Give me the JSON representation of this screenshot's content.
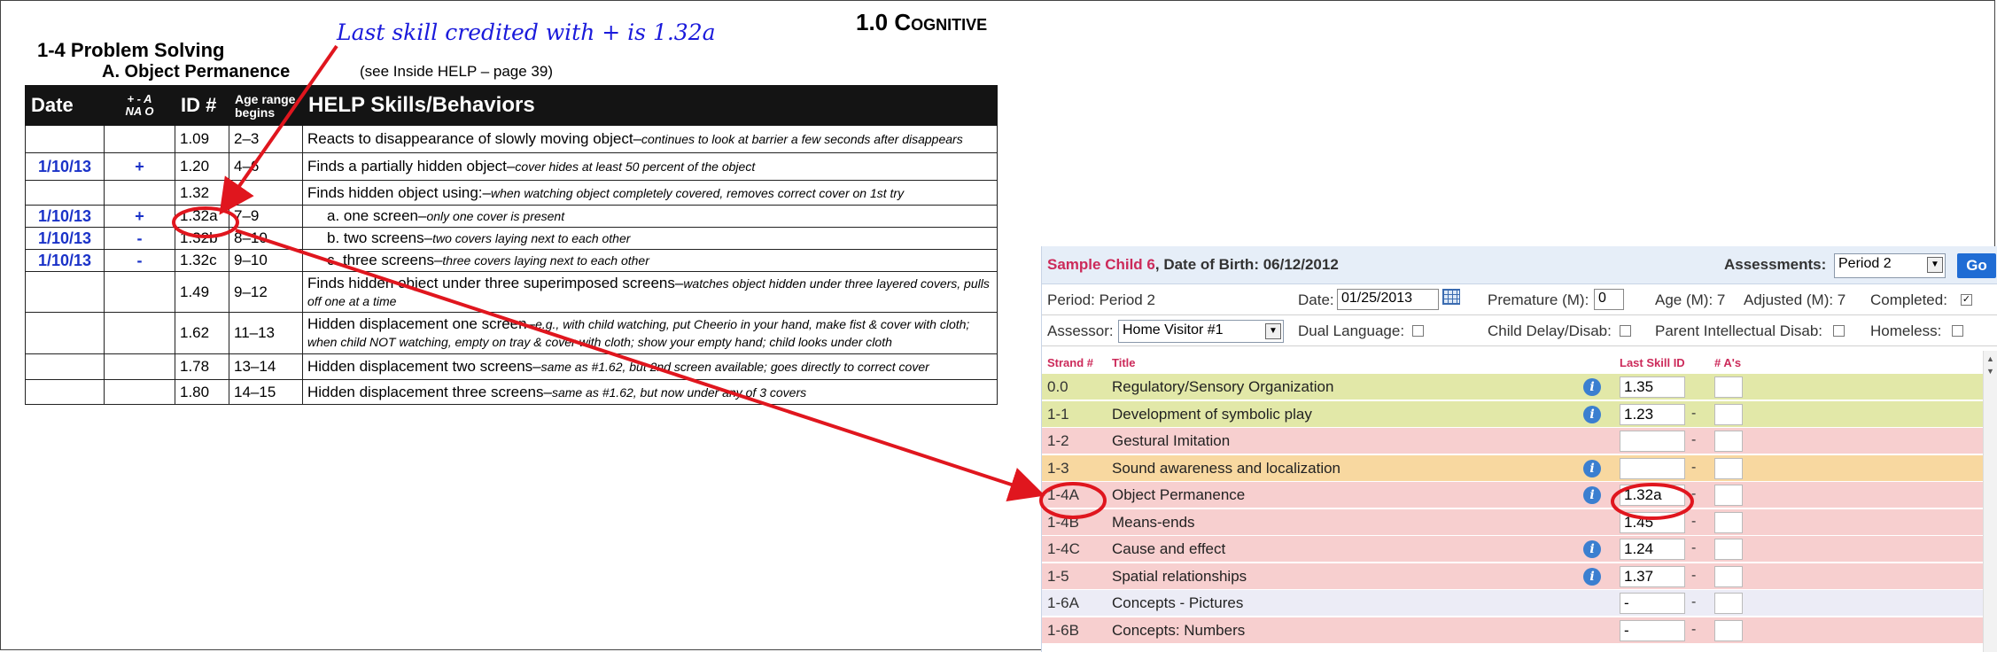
{
  "callout": "Last skill credited with + is 1.32a",
  "worksheet": {
    "domain_num": "1.0",
    "domain_name": "Cognitive",
    "section": "1-4 Problem Solving",
    "subsection": "A. Object Permanence",
    "reference": "(see Inside HELP – page 39)",
    "headers": {
      "date": "Date",
      "marks_top": "+ - A",
      "marks_bottom": "NA O",
      "id": "ID #",
      "age_top": "Age range",
      "age_bottom": "begins",
      "skills": "HELP Skills/Behaviors"
    },
    "rows": [
      {
        "date": "",
        "mark": "",
        "id": "1.09",
        "age": "2–3",
        "skill": "Reacts to disappearance of slowly moving object–",
        "desc": "continues to look at barrier a few seconds after disappears"
      },
      {
        "date": "1/10/13",
        "mark": "+",
        "id": "1.20",
        "age": "4–6",
        "skill": "Finds a partially hidden object–",
        "desc": "cover hides at least 50 percent of the object"
      },
      {
        "date": "",
        "mark": "",
        "id": "1.32",
        "age": "↓",
        "skill": "Finds hidden object using:–",
        "desc": "when watching object completely covered, removes correct cover on 1st try"
      },
      {
        "date": "1/10/13",
        "mark": "+",
        "id": "1.32a",
        "age": "7–9",
        "skill": "a. one screen–",
        "desc": "only one cover is present"
      },
      {
        "date": "1/10/13",
        "mark": "-",
        "id": "1.32b",
        "age": "8–10",
        "skill": "b. two screens–",
        "desc": "two covers laying next to each other"
      },
      {
        "date": "1/10/13",
        "mark": "-",
        "id": "1.32c",
        "age": "9–10",
        "skill": "c. three screens–",
        "desc": "three covers laying next to each other"
      },
      {
        "date": "",
        "mark": "",
        "id": "1.49",
        "age": "9–12",
        "skill": "Finds hidden object under three superimposed screens–",
        "desc": "watches object hidden under three layered covers, pulls off one at a time"
      },
      {
        "date": "",
        "mark": "",
        "id": "1.62",
        "age": "11–13",
        "skill": "Hidden displacement one screen–",
        "desc": "e.g., with child watching, put Cheerio in your hand, make fist & cover with cloth; when child NOT watching, empty on tray & cover with cloth; show your empty hand; child looks under cloth"
      },
      {
        "date": "",
        "mark": "",
        "id": "1.78",
        "age": "13–14",
        "skill": "Hidden displacement two screens–",
        "desc": "same as #1.62, but 2nd screen available; goes directly to correct cover"
      },
      {
        "date": "",
        "mark": "",
        "id": "1.80",
        "age": "14–15",
        "skill": "Hidden displacement three screens–",
        "desc": "same as #1.62, but now under any of 3 covers"
      }
    ]
  },
  "app": {
    "child_name": "Sample Child 6",
    "dob_label": ", Date of Birth: 06/12/2012",
    "assessments_label": "Assessments:",
    "assessment_value": "Period 2",
    "go_label": "Go",
    "period_label": "Period: Period 2",
    "date_label": "Date:",
    "date_value": "01/25/2013",
    "premature_label": "Premature (M):",
    "premature_value": "0",
    "age_label": "Age (M): 7",
    "adjusted_label": "Adjusted (M): 7",
    "completed_label": "Completed:",
    "assessor_label": "Assessor:",
    "assessor_value": "Home Visitor #1",
    "dual_language_label": "Dual Language:",
    "child_delay_label": "Child Delay/Disab:",
    "parent_disab_label": "Parent Intellectual Disab:",
    "homeless_label": "Homeless:",
    "grid_headers": {
      "strand": "Strand #",
      "title": "Title",
      "last_skill": "Last Skill ID",
      "a_count": "# A's"
    },
    "strands": [
      {
        "strand": "0.0",
        "title": "Regulatory/Sensory Organization",
        "info": true,
        "skill": "1.35",
        "dash": "",
        "color": "green"
      },
      {
        "strand": "1-1",
        "title": "Development of symbolic play",
        "info": true,
        "skill": "1.23",
        "dash": "-",
        "color": "green"
      },
      {
        "strand": "1-2",
        "title": "Gestural Imitation",
        "info": false,
        "skill": "",
        "dash": "-",
        "color": "pink"
      },
      {
        "strand": "1-3",
        "title": "Sound awareness and localization",
        "info": true,
        "skill": "",
        "dash": "-",
        "color": "orange"
      },
      {
        "strand": "1-4A",
        "title": "Object Permanence",
        "info": true,
        "skill": "1.32a",
        "dash": "-",
        "color": "pink"
      },
      {
        "strand": "1-4B",
        "title": "Means-ends",
        "info": false,
        "skill": "1.45",
        "dash": "-",
        "color": "pink"
      },
      {
        "strand": "1-4C",
        "title": "Cause and effect",
        "info": true,
        "skill": "1.24",
        "dash": "-",
        "color": "pink"
      },
      {
        "strand": "1-5",
        "title": "Spatial relationships",
        "info": true,
        "skill": "1.37",
        "dash": "-",
        "color": "pink"
      },
      {
        "strand": "1-6A",
        "title": "Concepts - Pictures",
        "info": false,
        "skill": "-",
        "dash": "-",
        "color": "lav"
      },
      {
        "strand": "1-6B",
        "title": "Concepts: Numbers",
        "info": false,
        "skill": "-",
        "dash": "-",
        "color": "pink"
      }
    ]
  }
}
